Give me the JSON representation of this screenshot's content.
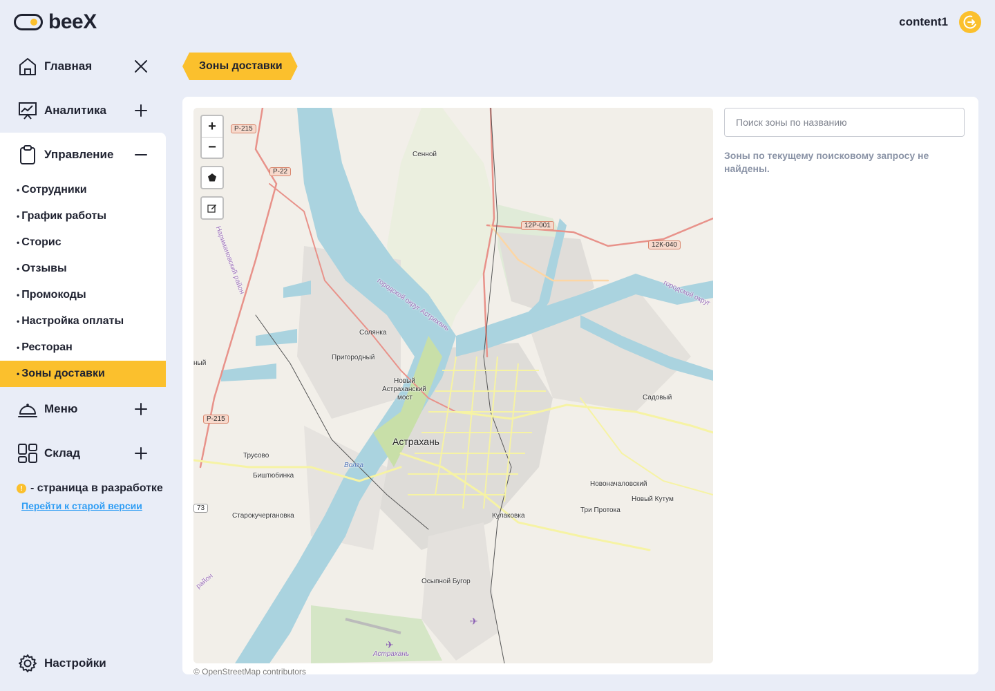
{
  "brand": {
    "name": "beeX"
  },
  "header": {
    "user_name": "content1"
  },
  "sidebar": {
    "main": {
      "label": "Главная"
    },
    "analytics": {
      "label": "Аналитика"
    },
    "management": {
      "label": "Управление",
      "items": [
        {
          "label": "Сотрудники"
        },
        {
          "label": "График работы"
        },
        {
          "label": "Сторис"
        },
        {
          "label": "Отзывы"
        },
        {
          "label": "Промокоды"
        },
        {
          "label": "Настройка оплаты"
        },
        {
          "label": "Ресторан"
        },
        {
          "label": "Зоны доставки",
          "active": true
        }
      ]
    },
    "menu": {
      "label": "Меню"
    },
    "warehouse": {
      "label": "Склад"
    },
    "dev_note": {
      "icon_text": "!",
      "text": "- страница в разработке",
      "link": "Перейти к старой версии"
    },
    "settings": {
      "label": "Настройки"
    }
  },
  "page": {
    "title": "Зоны доставки"
  },
  "search": {
    "placeholder": "Поиск зоны по названию",
    "value": ""
  },
  "empty_message": "Зоны по текущему поисковому запросу не найдены.",
  "map": {
    "zoom_in": "+",
    "zoom_out": "−",
    "attribution": "© OpenStreetMap contributors",
    "labels": {
      "city": "Астрахань",
      "sennoy": "Сенной",
      "solyanka": "Солянка",
      "prigorodny": "Пригородный",
      "novy_most_1": "Новый",
      "novy_most_2": "Астраханский",
      "novy_most_3": "мост",
      "trusovo": "Трусово",
      "bishtyubinka": "Биштюбинка",
      "starokucherganovka": "Старокучергановка",
      "volga": "Волга",
      "kulakovka": "Кулаковка",
      "osypnoy_bugor": "Осыпной Бугор",
      "sadovy": "Садовый",
      "novonachalovsky": "Новоначаловский",
      "novy_kutum": "Новый Кутум",
      "tri_protoka": "Три Протока",
      "airport": "Астрахань",
      "narimanov": "Наримановский район",
      "gor_okrug": "городской округ Астрахань",
      "gor_okrug_2": "городской округ",
      "rayon": "район",
      "nyi": "ный",
      "r73": "73"
    },
    "shields": {
      "p215_a": "Р-215",
      "p22": "Р-22",
      "p215_b": "Р-215",
      "r12p001": "12Р-001",
      "r12k040": "12К-040"
    }
  },
  "colors": {
    "accent": "#fbc02d",
    "background": "#e9edf7",
    "link": "#2f9df4",
    "water": "#aad3df"
  }
}
